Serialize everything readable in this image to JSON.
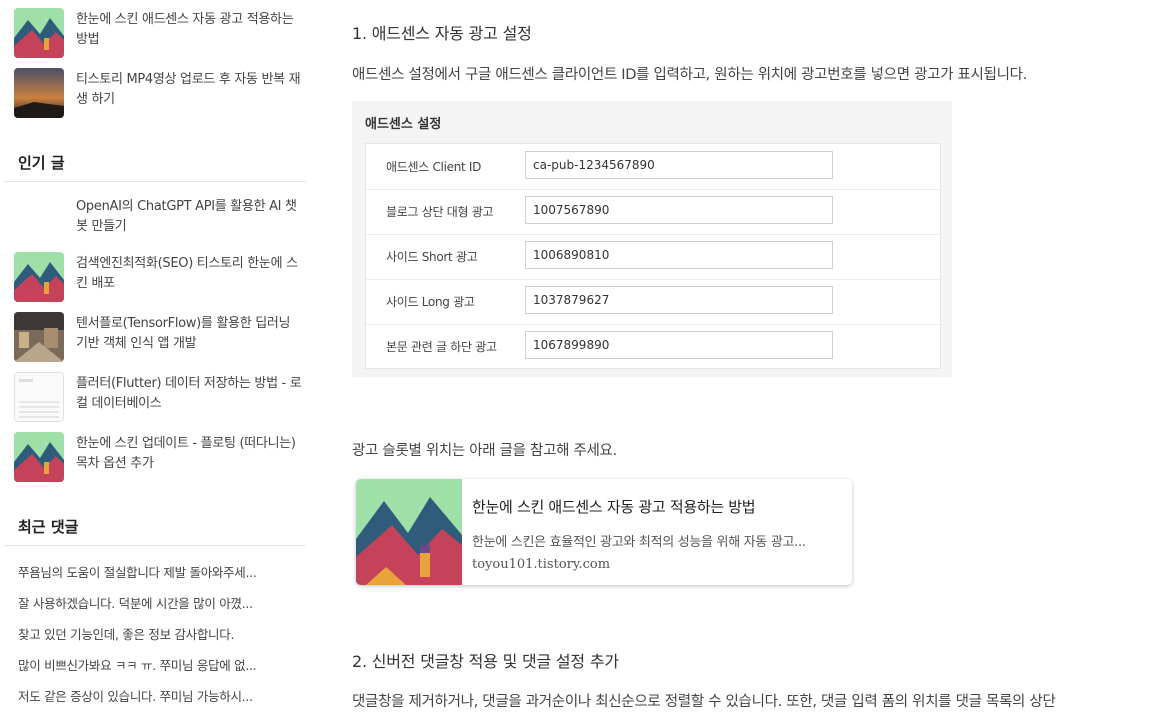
{
  "sidebar": {
    "recent_posts": [
      {
        "title": "한눈에 스킨 애드센스 자동 광고 적용하는 방법",
        "thumb": "mountain-landscape-image"
      },
      {
        "title": "티스토리 MP4영상 업로드 후 자동 반복 재생 하기",
        "thumb": "sunset-sky-image"
      }
    ],
    "popular_heading": "인기 글",
    "popular_posts": [
      {
        "title": "OpenAI의 ChatGPT API를 활용한 AI 챗봇 만들기",
        "thumb": "none"
      },
      {
        "title": "검색엔진최적화(SEO) 티스토리 한눈에 스킨 배포",
        "thumb": "mountain-landscape-image"
      },
      {
        "title": "텐서플로(TensorFlow)를 활용한 딥러닝 기반 객체 인식 앱 개발",
        "thumb": "street-photo-image"
      },
      {
        "title": "플러터(Flutter) 데이터 저장하는 방법 - 로컬 데이터베이스",
        "thumb": "phone-screen-image"
      },
      {
        "title": "한눈에 스킨 업데이트 - 플로팅 (떠다니는) 목차 옵션 추가",
        "thumb": "mountain-landscape-image"
      }
    ],
    "comments_heading": "최근 댓글",
    "comments": [
      "쭈욤님의 도움이 절실합니다 제발 돌아와주세...",
      "잘 사용하겠습니다. 덕분에 시간을 많이 아꼈...",
      "찾고 있던 기능인데, 좋은 정보 감사합니다.",
      "많이 비쁘신가봐요 ㅋㅋ ㅠ. 쭈미님 응답에 없...",
      "저도 같은 증상이 있습니다. 쭈미님 가능하시..."
    ]
  },
  "main": {
    "section1_heading": "1. 애드센스 자동 광고 설정",
    "section1_text": "애드센스 설정에서 구글 애드센스 클라이언트 ID를 입력하고, 원하는 위치에 광고번호를 넣으면 광고가 표시됩니다.",
    "settings": {
      "title": "애드센스 설정",
      "rows": [
        {
          "label": "애드센스 Client ID",
          "value": "ca-pub-1234567890"
        },
        {
          "label": "블로그 상단 대형 광고",
          "value": "1007567890"
        },
        {
          "label": "사이드 Short 광고",
          "value": "1006890810"
        },
        {
          "label": "사이드 Long 광고",
          "value": "1037879627"
        },
        {
          "label": "본문 관련 글 하단 광고",
          "value": "1067899890"
        }
      ]
    },
    "slot_text": "광고 슬롯별 위치는 아래 글을 참고해 주세요.",
    "link_card": {
      "title": "한눈에 스킨 애드센스 자동 광고 적용하는 방법",
      "description": "한눈에 스킨은 효율적인 광고와 최적의 성능을 위해 자동 광고...",
      "url": "toyou101.tistory.com",
      "thumb": "mountain-landscape-image"
    },
    "section2_heading": "2. 신버전 댓글창 적용 및 댓글 설정 추가",
    "section2_text": "댓글창을 제거하거나, 댓글을 과거순이나 최신순으로 정렬할 수 있습니다. 또한, 댓글 입력 폼의 위치를 댓글 목록의 상단"
  }
}
